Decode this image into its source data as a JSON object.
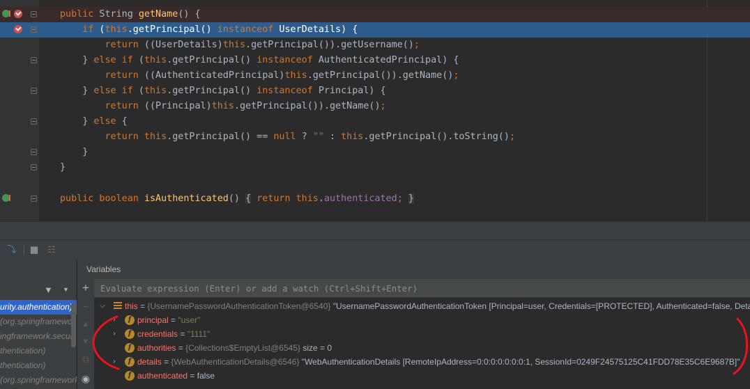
{
  "editor": {
    "lines": [
      {
        "text": "public String getName() {",
        "highlight": "red",
        "gutter": [
          "override-icon",
          "breakpoint-icon"
        ]
      },
      {
        "text": "    if (this.getPrincipal() instanceof UserDetails) {",
        "highlight": "blue",
        "gutter": [
          "breakpoint-icon"
        ]
      },
      {
        "text": "        return ((UserDetails)this.getPrincipal()).getUsername();"
      },
      {
        "text": "    } else if (this.getPrincipal() instanceof AuthenticatedPrincipal) {"
      },
      {
        "text": "        return ((AuthenticatedPrincipal)this.getPrincipal()).getName();"
      },
      {
        "text": "    } else if (this.getPrincipal() instanceof Principal) {"
      },
      {
        "text": "        return ((Principal)this.getPrincipal()).getName();"
      },
      {
        "text": "    } else {"
      },
      {
        "text": "        return this.getPrincipal() == null ? \"\" : this.getPrincipal().toString();"
      },
      {
        "text": "    }"
      },
      {
        "text": "}"
      },
      {
        "text": ""
      },
      {
        "text": "public boolean isAuthenticated() { return this.authenticated; }",
        "gutter": [
          "override-icon"
        ]
      }
    ]
  },
  "toolstrip": {
    "icons": [
      "show-execution-point-icon",
      "evaluate-table-icon",
      "layout-settings-icon"
    ]
  },
  "frames": {
    "items": [
      "urity.authentication)",
      " (org.springframewor",
      "ingframework.securi",
      "thentication)",
      "thentication)",
      " (org.springframework.s"
    ],
    "selected_index": 0
  },
  "variables": {
    "title": "Variables",
    "evaluate_placeholder": "Evaluate expression (Enter) or add a watch (Ctrl+Shift+Enter)",
    "root": {
      "name": "this",
      "eq": " = ",
      "type": "{UsernamePasswordAuthenticationToken@6540}",
      "value": " \"UsernamePasswordAuthenticationToken [Principal=user, Credentials=[PROTECTED], Authenticated=false, Deta"
    },
    "fields": [
      {
        "name": "principal",
        "eq": " = ",
        "value": "\"user\"",
        "expandable": true
      },
      {
        "name": "credentials",
        "eq": " = ",
        "value": "\"1111\"",
        "expandable": true
      },
      {
        "name": "authorities",
        "eq": " = ",
        "type": "{Collections$EmptyList@6545}",
        "extra": "  size = 0",
        "expandable": false
      },
      {
        "name": "details",
        "eq": " = ",
        "type": "{WebAuthenticationDetails@6546}",
        "value": " \"WebAuthenticationDetails [RemoteIpAddress=0:0:0:0:0:0:0:1, SessionId=0249F24575125C41FDD78E35C6E9687B]\"",
        "expandable": true
      },
      {
        "name": "authenticated",
        "eq": " = ",
        "value": "false",
        "expandable": false
      }
    ]
  },
  "colors": {
    "keyword": "#cc7832",
    "method": "#ffc66d",
    "field": "#9876aa",
    "string": "#6a8759",
    "selection": "#2d5c8c",
    "annotation": "#e8161c"
  }
}
